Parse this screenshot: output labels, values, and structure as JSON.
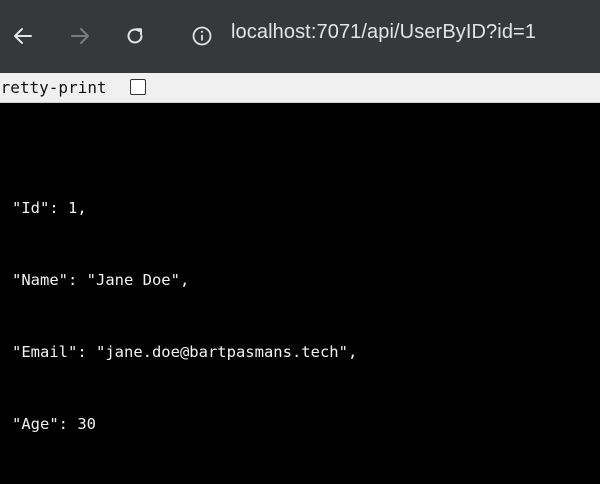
{
  "toolbar": {
    "url": "localhost:7071/api/UserByID?id=1"
  },
  "pretty_print": {
    "label": "Pretty-print",
    "checked": false
  },
  "json_lines": [
    "\"Id\": 1,",
    "\"Name\": \"Jane Doe\",",
    "\"Email\": \"jane.doe@bartpasmans.tech\",",
    "\"Age\": 30"
  ],
  "colors": {
    "toolbar_bg": "#36383b",
    "content_bg": "#000000",
    "text": "#f2f2f2"
  }
}
